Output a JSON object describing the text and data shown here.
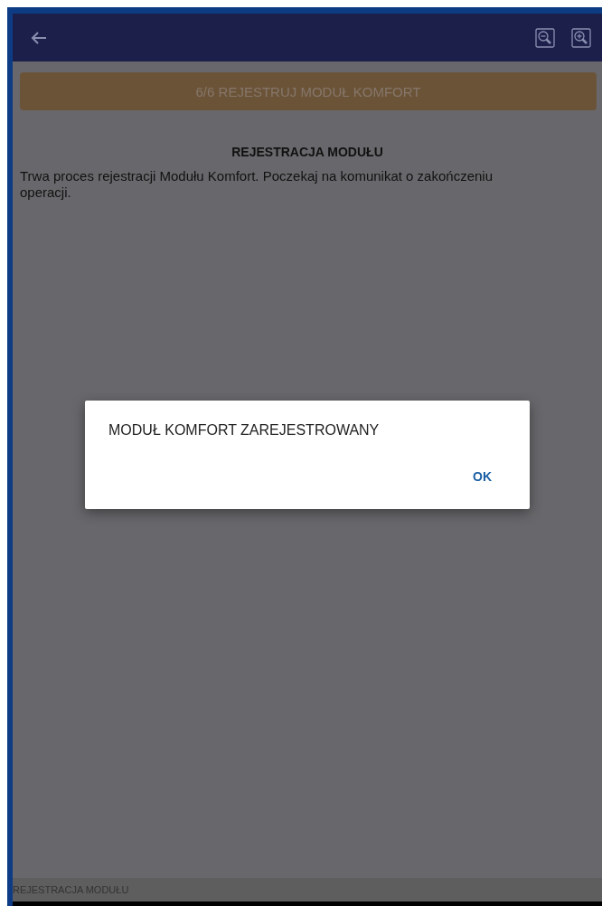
{
  "step_button": {
    "label": "6/6 REJESTRUJ MODUŁ KOMFORT",
    "disabled": true
  },
  "section": {
    "title": "REJESTRACJA MODUŁU",
    "text": "Trwa proces rejestracji Modułu Komfort. Poczekaj na komunikat o zakończeniu operacji."
  },
  "dialog": {
    "message": "MODUŁ KOMFORT ZAREJESTROWANY",
    "button": "OK"
  },
  "status_bar": {
    "text": "REJESTRACJA MODUŁU"
  }
}
